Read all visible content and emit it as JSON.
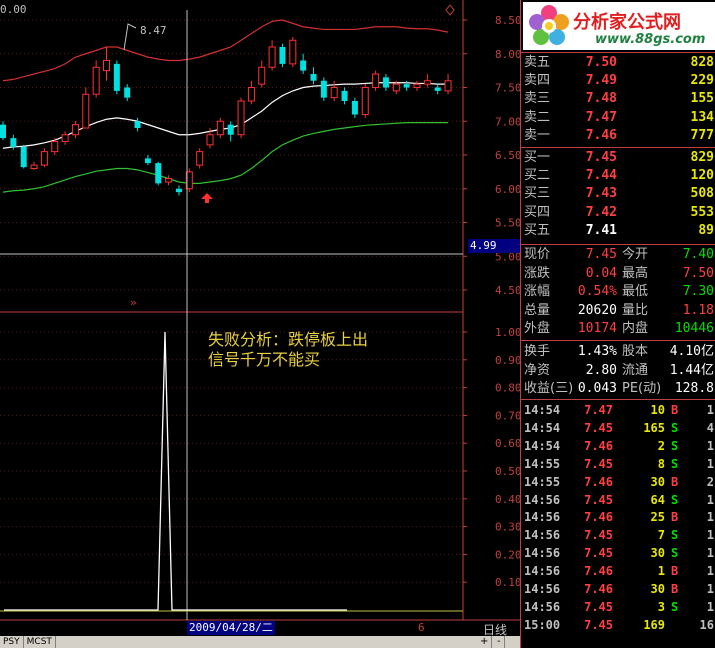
{
  "header": {
    "topleft": "0.00"
  },
  "chart_data": [
    {
      "type": "candlestick",
      "ylim": [
        4.5,
        8.5
      ],
      "yticks": [
        "8.50",
        "8.00",
        "7.50",
        "7.00",
        "6.50",
        "6.00",
        "5.50",
        "5.00",
        "4.50"
      ],
      "candles": [
        [
          6.95,
          6.75,
          7.0,
          6.72
        ],
        [
          6.75,
          6.62,
          6.8,
          6.58
        ],
        [
          6.62,
          6.32,
          6.65,
          6.3
        ],
        [
          6.3,
          6.35,
          6.4,
          6.28
        ],
        [
          6.35,
          6.55,
          6.6,
          6.32
        ],
        [
          6.55,
          6.7,
          6.75,
          6.5
        ],
        [
          6.7,
          6.8,
          6.85,
          6.65
        ],
        [
          6.8,
          6.95,
          7.0,
          6.75
        ],
        [
          6.9,
          7.4,
          7.5,
          6.9
        ],
        [
          7.4,
          7.8,
          7.9,
          7.35
        ],
        [
          7.75,
          7.9,
          8.1,
          7.6
        ],
        [
          7.85,
          7.45,
          7.9,
          7.4
        ],
        [
          7.5,
          7.35,
          7.55,
          7.3
        ],
        [
          7.0,
          6.9,
          7.05,
          6.85
        ],
        [
          6.45,
          6.38,
          6.5,
          6.35
        ],
        [
          6.38,
          6.08,
          6.4,
          6.05
        ],
        [
          6.1,
          6.15,
          6.2,
          6.05
        ],
        [
          6.0,
          5.95,
          6.05,
          5.9
        ],
        [
          6.0,
          6.25,
          6.3,
          5.95
        ],
        [
          6.35,
          6.55,
          6.6,
          6.3
        ],
        [
          6.65,
          6.8,
          6.9,
          6.6
        ],
        [
          6.8,
          7.0,
          7.05,
          6.75
        ],
        [
          6.95,
          6.8,
          7.0,
          6.7
        ],
        [
          6.8,
          7.3,
          7.35,
          6.75
        ],
        [
          7.3,
          7.5,
          7.6,
          7.25
        ],
        [
          7.55,
          7.8,
          7.9,
          7.5
        ],
        [
          7.8,
          8.1,
          8.2,
          7.75
        ],
        [
          8.1,
          7.85,
          8.15,
          7.8
        ],
        [
          7.85,
          8.2,
          8.25,
          7.8
        ],
        [
          7.9,
          7.75,
          8.0,
          7.7
        ],
        [
          7.7,
          7.6,
          7.8,
          7.55
        ],
        [
          7.6,
          7.35,
          7.65,
          7.3
        ],
        [
          7.35,
          7.5,
          7.6,
          7.3
        ],
        [
          7.45,
          7.3,
          7.5,
          7.25
        ],
        [
          7.3,
          7.1,
          7.35,
          7.05
        ],
        [
          7.1,
          7.5,
          7.55,
          7.05
        ],
        [
          7.5,
          7.7,
          7.75,
          7.45
        ],
        [
          7.65,
          7.5,
          7.7,
          7.45
        ],
        [
          7.45,
          7.55,
          7.6,
          7.4
        ],
        [
          7.55,
          7.5,
          7.6,
          7.45
        ],
        [
          7.5,
          7.55,
          7.6,
          7.45
        ],
        [
          7.55,
          7.6,
          7.7,
          7.5
        ],
        [
          7.5,
          7.45,
          7.55,
          7.4
        ],
        [
          7.45,
          7.6,
          7.7,
          7.4
        ]
      ],
      "upper_band": [
        7.6,
        7.62,
        7.66,
        7.7,
        7.74,
        7.78,
        7.85,
        7.95,
        8.0,
        8.05,
        8.1,
        8.1,
        8.05,
        8.0,
        7.95,
        7.92,
        7.9,
        7.9,
        7.92,
        7.95,
        8.0,
        8.05,
        8.1,
        8.2,
        8.3,
        8.4,
        8.48,
        8.5,
        8.45,
        8.4,
        8.38,
        8.36,
        8.36,
        8.36,
        8.36,
        8.38,
        8.4,
        8.4,
        8.4,
        8.38,
        8.37,
        8.37,
        8.35,
        8.32
      ],
      "mid_band": [
        6.6,
        6.62,
        6.63,
        6.65,
        6.68,
        6.72,
        6.78,
        6.85,
        6.92,
        6.98,
        7.03,
        7.05,
        7.03,
        7.0,
        6.95,
        6.9,
        6.85,
        6.8,
        6.8,
        6.82,
        6.85,
        6.88,
        6.9,
        6.95,
        7.05,
        7.15,
        7.28,
        7.38,
        7.45,
        7.5,
        7.52,
        7.53,
        7.54,
        7.55,
        7.55,
        7.56,
        7.57,
        7.57,
        7.57,
        7.57,
        7.56,
        7.56,
        7.55,
        7.55
      ],
      "lower_band": [
        5.95,
        5.97,
        5.98,
        6.0,
        6.03,
        6.08,
        6.13,
        6.18,
        6.22,
        6.26,
        6.28,
        6.3,
        6.3,
        6.28,
        6.24,
        6.2,
        6.15,
        6.1,
        6.08,
        6.08,
        6.1,
        6.12,
        6.15,
        6.2,
        6.3,
        6.42,
        6.55,
        6.65,
        6.72,
        6.78,
        6.82,
        6.85,
        6.88,
        6.9,
        6.92,
        6.94,
        6.95,
        6.96,
        6.97,
        6.98,
        6.98,
        6.98,
        6.98,
        6.98
      ],
      "peak_label": "8.47",
      "current_price_label": "4.99"
    },
    {
      "type": "line",
      "ylim": [
        0,
        1
      ],
      "yticks": [
        "1.00",
        "0.90",
        "0.80",
        "0.70",
        "0.60",
        "0.50",
        "0.40",
        "0.30",
        "0.20",
        "0.10"
      ],
      "values": [
        0,
        0,
        0,
        0,
        0,
        0,
        0,
        0,
        0,
        0,
        0,
        0,
        0,
        0,
        0,
        0,
        0,
        0,
        0,
        0,
        0,
        0,
        0,
        1,
        0,
        0,
        0,
        0,
        0,
        0,
        0,
        0,
        0,
        0,
        0,
        0,
        0,
        0,
        0,
        0,
        0,
        0,
        0,
        0,
        0,
        0,
        0,
        0,
        0,
        0
      ]
    }
  ],
  "annotation": {
    "line1": "失败分析：跌停板上出",
    "line2": "信号千万不能买"
  },
  "xaxis": {
    "cursor_date": "2009/04/28/二",
    "tick": "6",
    "period": "日线"
  },
  "tabs": [
    "PSY",
    "MCST"
  ],
  "logo": {
    "title": "分析家公式网",
    "url": "www.88gs.com"
  },
  "sell_orders": [
    {
      "label": "卖五",
      "price": "7.50",
      "vol": "828"
    },
    {
      "label": "卖四",
      "price": "7.49",
      "vol": "229"
    },
    {
      "label": "卖三",
      "price": "7.48",
      "vol": "155"
    },
    {
      "label": "卖二",
      "price": "7.47",
      "vol": "134"
    },
    {
      "label": "卖一",
      "price": "7.46",
      "vol": "777"
    }
  ],
  "buy_orders": [
    {
      "label": "买一",
      "price": "7.45",
      "vol": "829"
    },
    {
      "label": "买二",
      "price": "7.44",
      "vol": "120"
    },
    {
      "label": "买三",
      "price": "7.43",
      "vol": "508"
    },
    {
      "label": "买四",
      "price": "7.42",
      "vol": "553"
    },
    {
      "label": "买五",
      "price": "7.41",
      "vol": "89"
    }
  ],
  "quote": [
    {
      "k1": "现价",
      "v1": "7.45",
      "c1": "red",
      "k2": "今开",
      "v2": "7.40",
      "c2": "green"
    },
    {
      "k1": "涨跌",
      "v1": "0.04",
      "c1": "red",
      "k2": "最高",
      "v2": "7.50",
      "c2": "red"
    },
    {
      "k1": "涨幅",
      "v1": "0.54%",
      "c1": "red",
      "k2": "最低",
      "v2": "7.30",
      "c2": "green"
    },
    {
      "k1": "总量",
      "v1": "20620",
      "c1": "white",
      "k2": "量比",
      "v2": "1.18",
      "c2": "red"
    },
    {
      "k1": "外盘",
      "v1": "10174",
      "c1": "red",
      "k2": "内盘",
      "v2": "10446",
      "c2": "green"
    }
  ],
  "finance": [
    {
      "k1": "换手",
      "v1": "1.43%",
      "k2": "股本",
      "v2": "4.10亿"
    },
    {
      "k1": "净资",
      "v1": "2.80",
      "k2": "流通",
      "v2": "1.44亿"
    },
    {
      "k1": "收益(三)",
      "v1": "0.043",
      "k2": "PE(动)",
      "v2": "128.8"
    }
  ],
  "ticks": [
    {
      "t": "14:54",
      "p": "7.47",
      "v": "10",
      "d": "B",
      "n": "1"
    },
    {
      "t": "14:54",
      "p": "7.45",
      "v": "165",
      "d": "S",
      "n": "4"
    },
    {
      "t": "14:54",
      "p": "7.46",
      "v": "2",
      "d": "S",
      "n": "1"
    },
    {
      "t": "14:55",
      "p": "7.45",
      "v": "8",
      "d": "S",
      "n": "1"
    },
    {
      "t": "14:55",
      "p": "7.46",
      "v": "30",
      "d": "B",
      "n": "2"
    },
    {
      "t": "14:56",
      "p": "7.45",
      "v": "64",
      "d": "S",
      "n": "1"
    },
    {
      "t": "14:56",
      "p": "7.46",
      "v": "25",
      "d": "B",
      "n": "1"
    },
    {
      "t": "14:56",
      "p": "7.45",
      "v": "7",
      "d": "S",
      "n": "1"
    },
    {
      "t": "14:56",
      "p": "7.45",
      "v": "30",
      "d": "S",
      "n": "1"
    },
    {
      "t": "14:56",
      "p": "7.46",
      "v": "1",
      "d": "B",
      "n": "1"
    },
    {
      "t": "14:56",
      "p": "7.46",
      "v": "30",
      "d": "B",
      "n": "1"
    },
    {
      "t": "14:56",
      "p": "7.45",
      "v": "3",
      "d": "S",
      "n": "1"
    },
    {
      "t": "15:00",
      "p": "7.45",
      "v": "169",
      "d": "",
      "n": "16"
    }
  ]
}
